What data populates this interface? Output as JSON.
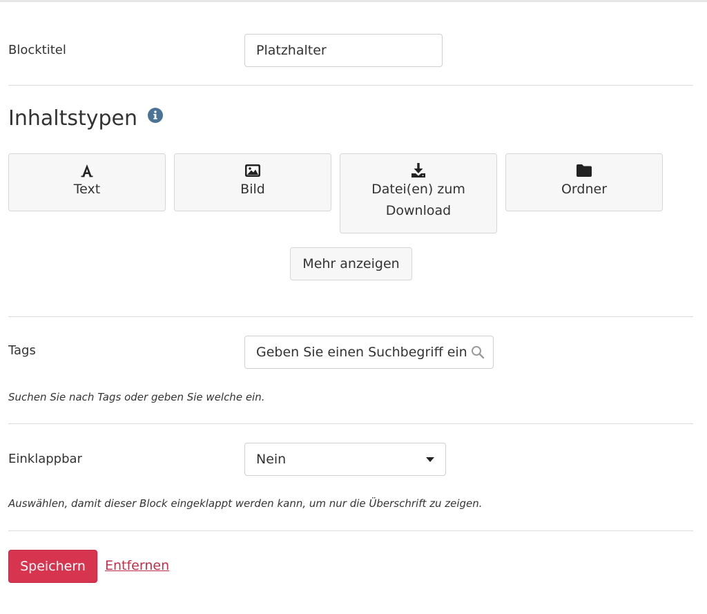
{
  "block_title": {
    "label": "Blocktitel",
    "value": "Platzhalter"
  },
  "content_types": {
    "title": "Inhaltstypen",
    "types": [
      {
        "label": "Text",
        "icon": "font-icon"
      },
      {
        "label": "Bild",
        "icon": "image-icon"
      },
      {
        "label": "Datei(en) zum Download",
        "icon": "download-icon"
      },
      {
        "label": "Ordner",
        "icon": "folder-icon"
      }
    ],
    "more_label": "Mehr anzeigen"
  },
  "tags": {
    "label": "Tags",
    "placeholder": "Geben Sie einen Suchbegriff ein",
    "help": "Suchen Sie nach Tags oder geben Sie welche ein."
  },
  "collapsible": {
    "label": "Einklappbar",
    "selected": "Nein",
    "help": "Auswählen, damit dieser Block eingeklappt werden kann, um nur die Überschrift zu zeigen."
  },
  "actions": {
    "save_label": "Speichern",
    "remove_label": "Entfernen"
  },
  "colors": {
    "accent": "#d7344f",
    "info": "#4a7396"
  }
}
